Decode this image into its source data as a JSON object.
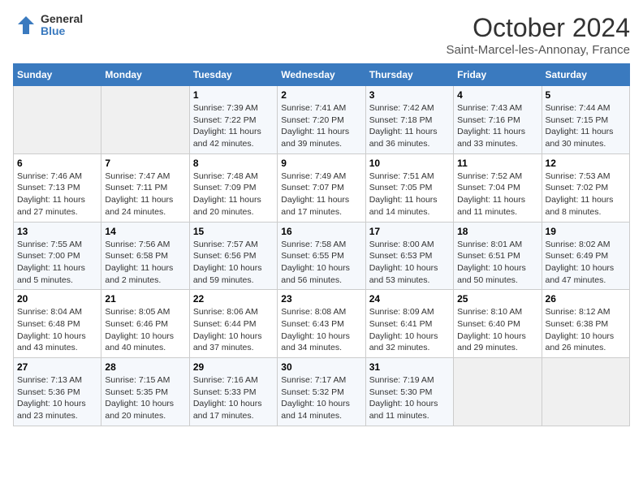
{
  "header": {
    "logo_line1": "General",
    "logo_line2": "Blue",
    "title": "October 2024",
    "subtitle": "Saint-Marcel-les-Annonay, France"
  },
  "days_of_week": [
    "Sunday",
    "Monday",
    "Tuesday",
    "Wednesday",
    "Thursday",
    "Friday",
    "Saturday"
  ],
  "weeks": [
    [
      {
        "day": "",
        "info": ""
      },
      {
        "day": "",
        "info": ""
      },
      {
        "day": "1",
        "info": "Sunrise: 7:39 AM\nSunset: 7:22 PM\nDaylight: 11 hours and 42 minutes."
      },
      {
        "day": "2",
        "info": "Sunrise: 7:41 AM\nSunset: 7:20 PM\nDaylight: 11 hours and 39 minutes."
      },
      {
        "day": "3",
        "info": "Sunrise: 7:42 AM\nSunset: 7:18 PM\nDaylight: 11 hours and 36 minutes."
      },
      {
        "day": "4",
        "info": "Sunrise: 7:43 AM\nSunset: 7:16 PM\nDaylight: 11 hours and 33 minutes."
      },
      {
        "day": "5",
        "info": "Sunrise: 7:44 AM\nSunset: 7:15 PM\nDaylight: 11 hours and 30 minutes."
      }
    ],
    [
      {
        "day": "6",
        "info": "Sunrise: 7:46 AM\nSunset: 7:13 PM\nDaylight: 11 hours and 27 minutes."
      },
      {
        "day": "7",
        "info": "Sunrise: 7:47 AM\nSunset: 7:11 PM\nDaylight: 11 hours and 24 minutes."
      },
      {
        "day": "8",
        "info": "Sunrise: 7:48 AM\nSunset: 7:09 PM\nDaylight: 11 hours and 20 minutes."
      },
      {
        "day": "9",
        "info": "Sunrise: 7:49 AM\nSunset: 7:07 PM\nDaylight: 11 hours and 17 minutes."
      },
      {
        "day": "10",
        "info": "Sunrise: 7:51 AM\nSunset: 7:05 PM\nDaylight: 11 hours and 14 minutes."
      },
      {
        "day": "11",
        "info": "Sunrise: 7:52 AM\nSunset: 7:04 PM\nDaylight: 11 hours and 11 minutes."
      },
      {
        "day": "12",
        "info": "Sunrise: 7:53 AM\nSunset: 7:02 PM\nDaylight: 11 hours and 8 minutes."
      }
    ],
    [
      {
        "day": "13",
        "info": "Sunrise: 7:55 AM\nSunset: 7:00 PM\nDaylight: 11 hours and 5 minutes."
      },
      {
        "day": "14",
        "info": "Sunrise: 7:56 AM\nSunset: 6:58 PM\nDaylight: 11 hours and 2 minutes."
      },
      {
        "day": "15",
        "info": "Sunrise: 7:57 AM\nSunset: 6:56 PM\nDaylight: 10 hours and 59 minutes."
      },
      {
        "day": "16",
        "info": "Sunrise: 7:58 AM\nSunset: 6:55 PM\nDaylight: 10 hours and 56 minutes."
      },
      {
        "day": "17",
        "info": "Sunrise: 8:00 AM\nSunset: 6:53 PM\nDaylight: 10 hours and 53 minutes."
      },
      {
        "day": "18",
        "info": "Sunrise: 8:01 AM\nSunset: 6:51 PM\nDaylight: 10 hours and 50 minutes."
      },
      {
        "day": "19",
        "info": "Sunrise: 8:02 AM\nSunset: 6:49 PM\nDaylight: 10 hours and 47 minutes."
      }
    ],
    [
      {
        "day": "20",
        "info": "Sunrise: 8:04 AM\nSunset: 6:48 PM\nDaylight: 10 hours and 43 minutes."
      },
      {
        "day": "21",
        "info": "Sunrise: 8:05 AM\nSunset: 6:46 PM\nDaylight: 10 hours and 40 minutes."
      },
      {
        "day": "22",
        "info": "Sunrise: 8:06 AM\nSunset: 6:44 PM\nDaylight: 10 hours and 37 minutes."
      },
      {
        "day": "23",
        "info": "Sunrise: 8:08 AM\nSunset: 6:43 PM\nDaylight: 10 hours and 34 minutes."
      },
      {
        "day": "24",
        "info": "Sunrise: 8:09 AM\nSunset: 6:41 PM\nDaylight: 10 hours and 32 minutes."
      },
      {
        "day": "25",
        "info": "Sunrise: 8:10 AM\nSunset: 6:40 PM\nDaylight: 10 hours and 29 minutes."
      },
      {
        "day": "26",
        "info": "Sunrise: 8:12 AM\nSunset: 6:38 PM\nDaylight: 10 hours and 26 minutes."
      }
    ],
    [
      {
        "day": "27",
        "info": "Sunrise: 7:13 AM\nSunset: 5:36 PM\nDaylight: 10 hours and 23 minutes."
      },
      {
        "day": "28",
        "info": "Sunrise: 7:15 AM\nSunset: 5:35 PM\nDaylight: 10 hours and 20 minutes."
      },
      {
        "day": "29",
        "info": "Sunrise: 7:16 AM\nSunset: 5:33 PM\nDaylight: 10 hours and 17 minutes."
      },
      {
        "day": "30",
        "info": "Sunrise: 7:17 AM\nSunset: 5:32 PM\nDaylight: 10 hours and 14 minutes."
      },
      {
        "day": "31",
        "info": "Sunrise: 7:19 AM\nSunset: 5:30 PM\nDaylight: 10 hours and 11 minutes."
      },
      {
        "day": "",
        "info": ""
      },
      {
        "day": "",
        "info": ""
      }
    ]
  ]
}
